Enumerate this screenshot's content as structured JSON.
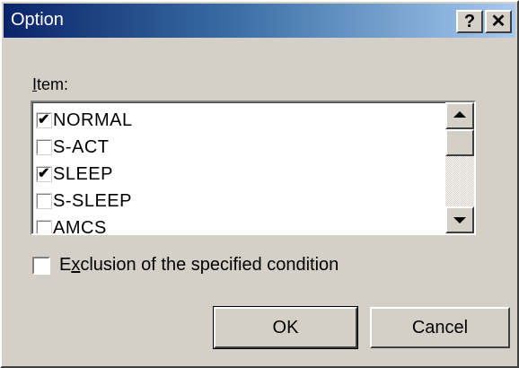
{
  "window": {
    "title": "Option",
    "help_label": "?",
    "close_label": "✕"
  },
  "item_list": {
    "label": "Item:",
    "items": [
      {
        "label": "NORMAL",
        "checked": true
      },
      {
        "label": "S-ACT",
        "checked": false
      },
      {
        "label": "SLEEP",
        "checked": true
      },
      {
        "label": "S-SLEEP",
        "checked": false
      },
      {
        "label": "AMCS",
        "checked": false
      }
    ]
  },
  "exclusion": {
    "label": "Exclusion of the specified condition",
    "checked": false
  },
  "buttons": {
    "ok_label": "OK",
    "cancel_label": "Cancel"
  },
  "icons": {
    "check": "checkmark-icon",
    "scroll_up": "arrow-up-icon",
    "scroll_down": "arrow-down-icon"
  },
  "colors": {
    "title_gradient_start": "#0a246a",
    "title_gradient_end": "#a6caf0",
    "face": "#d4d0c8"
  }
}
